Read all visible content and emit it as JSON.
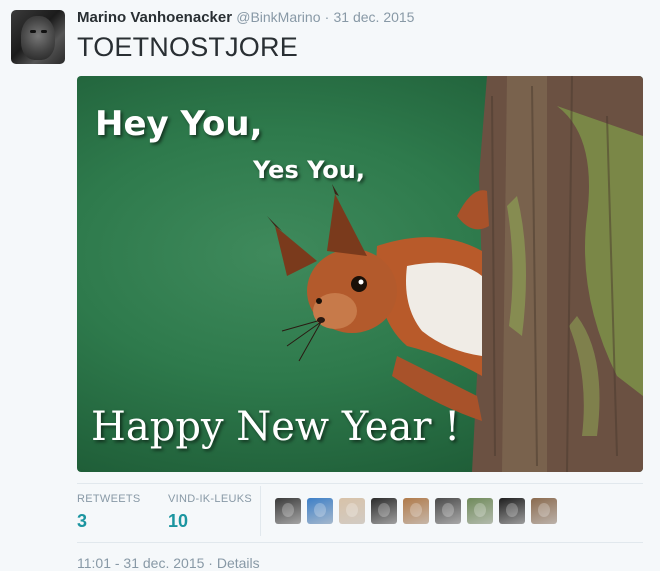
{
  "tweet": {
    "author_name": "Marino Vanhoenacker",
    "handle": "@BinkMarino",
    "separator": "·",
    "date": "31 dec. 2015",
    "text": "TOETNOSTJORE"
  },
  "media": {
    "caption_line1": "Hey You,",
    "caption_line2": "Yes You,",
    "caption_line3": "Happy New Year !"
  },
  "stats": {
    "retweets_label": "RETWEETS",
    "retweets_count": "3",
    "likes_label": "VIND-IK-LEUKS",
    "likes_count": "10"
  },
  "likers": [
    {
      "name": "liker-avatar-1",
      "color": "#3a3a3a"
    },
    {
      "name": "liker-avatar-2",
      "color": "#3d7fc7"
    },
    {
      "name": "liker-avatar-3",
      "color": "#d8c2a8"
    },
    {
      "name": "liker-avatar-4",
      "color": "#2b2b2b"
    },
    {
      "name": "liker-avatar-5",
      "color": "#b07a4a"
    },
    {
      "name": "liker-avatar-6",
      "color": "#4a4a4a"
    },
    {
      "name": "liker-avatar-7",
      "color": "#6f8a5a"
    },
    {
      "name": "liker-avatar-8",
      "color": "#1e1e1e"
    },
    {
      "name": "liker-avatar-9",
      "color": "#8a6a4e"
    }
  ],
  "footer": {
    "timestamp": "11:01 - 31 dec. 2015 · Details"
  },
  "colors": {
    "count_accent": "#1b95a0",
    "muted_text": "#8899a6",
    "background": "#f5f8fa"
  }
}
